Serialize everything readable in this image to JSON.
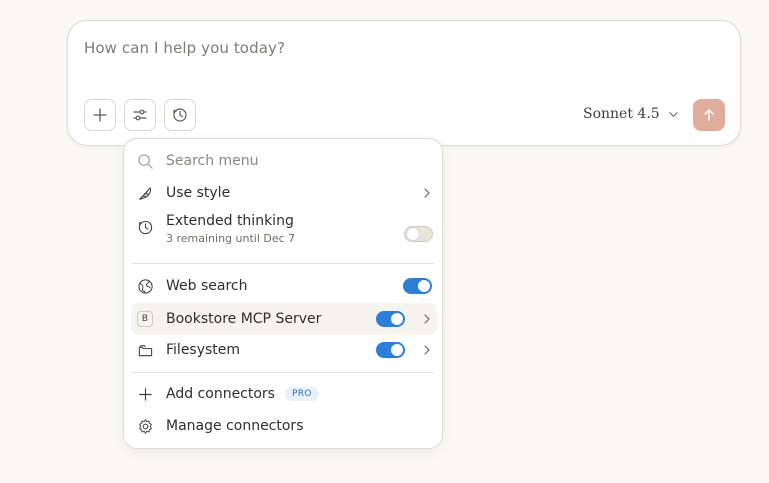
{
  "composer": {
    "placeholder": "How can I help you today?",
    "model": "Sonnet 4.5"
  },
  "menu": {
    "search_placeholder": "Search menu",
    "use_style": "Use style",
    "extended_thinking": {
      "label": "Extended thinking",
      "sub": "3 remaining until Dec 7",
      "enabled": false
    },
    "web_search": {
      "label": "Web search",
      "enabled": true
    },
    "bookstore": {
      "label": "Bookstore MCP Server",
      "badge": "B",
      "enabled": true
    },
    "filesystem": {
      "label": "Filesystem",
      "enabled": true
    },
    "add_connectors": {
      "label": "Add connectors",
      "badge": "PRO"
    },
    "manage_connectors": "Manage connectors"
  },
  "colors": {
    "background": "#faf9f5",
    "accent_toggle": "#2b7fd6",
    "send_button": "#e0ad9c"
  }
}
